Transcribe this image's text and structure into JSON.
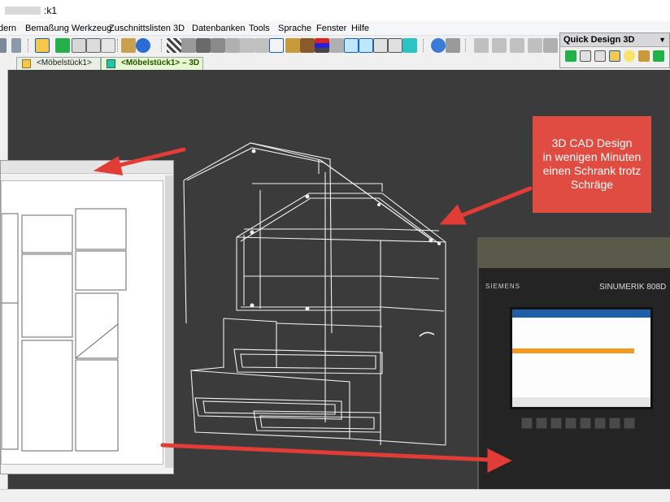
{
  "window": {
    "title_suffix": ":k1"
  },
  "menu": {
    "items": [
      "dern",
      "Bemaßung Werkzeug",
      "Zuschnittslisten",
      "3D",
      "Datenbanken",
      "Tools",
      "Sprache",
      "Fenster",
      "Hilfe"
    ]
  },
  "quick_design": {
    "title": "Quick Design 3D"
  },
  "tabs": [
    {
      "label": "<Möbelstück1>"
    },
    {
      "label": "<Möbelstück1> – 3D"
    }
  ],
  "callout": {
    "lines": [
      "3D CAD Design",
      "in wenigen Minuten",
      "einen Schrank trotz",
      "Schräge"
    ]
  },
  "machine_photo": {
    "brand": "SIEMENS",
    "model": "SINUMERIK 808D"
  },
  "colors": {
    "viewport_bg": "#3b3b3b",
    "callout_bg": "#e14c42",
    "arrow": "#e23c36",
    "wireframe": "#f0f0f0",
    "active_tab_bg": "#e9f7d0"
  },
  "icons": {
    "toolbar": [
      "undo-icon",
      "redo-icon",
      "select-icon",
      "cube-green-icon",
      "cube-outline-icon",
      "pen-icon",
      "info-icon",
      "grid-icon",
      "panel-icon",
      "cross-icon",
      "arrow-h-icon",
      "arrow-v-icon",
      "measure-icon",
      "pencil-icon",
      "layers-icon",
      "cube-3d-icon",
      "wire-cube-icon",
      "settings-icon",
      "list-icon"
    ],
    "quick_design": [
      "cube-green-icon",
      "cube-outline-icon",
      "cabinet-icon",
      "door-icon",
      "lightbulb-icon",
      "pencil-icon",
      "cube-green-small-icon",
      "wrench-icon"
    ]
  }
}
